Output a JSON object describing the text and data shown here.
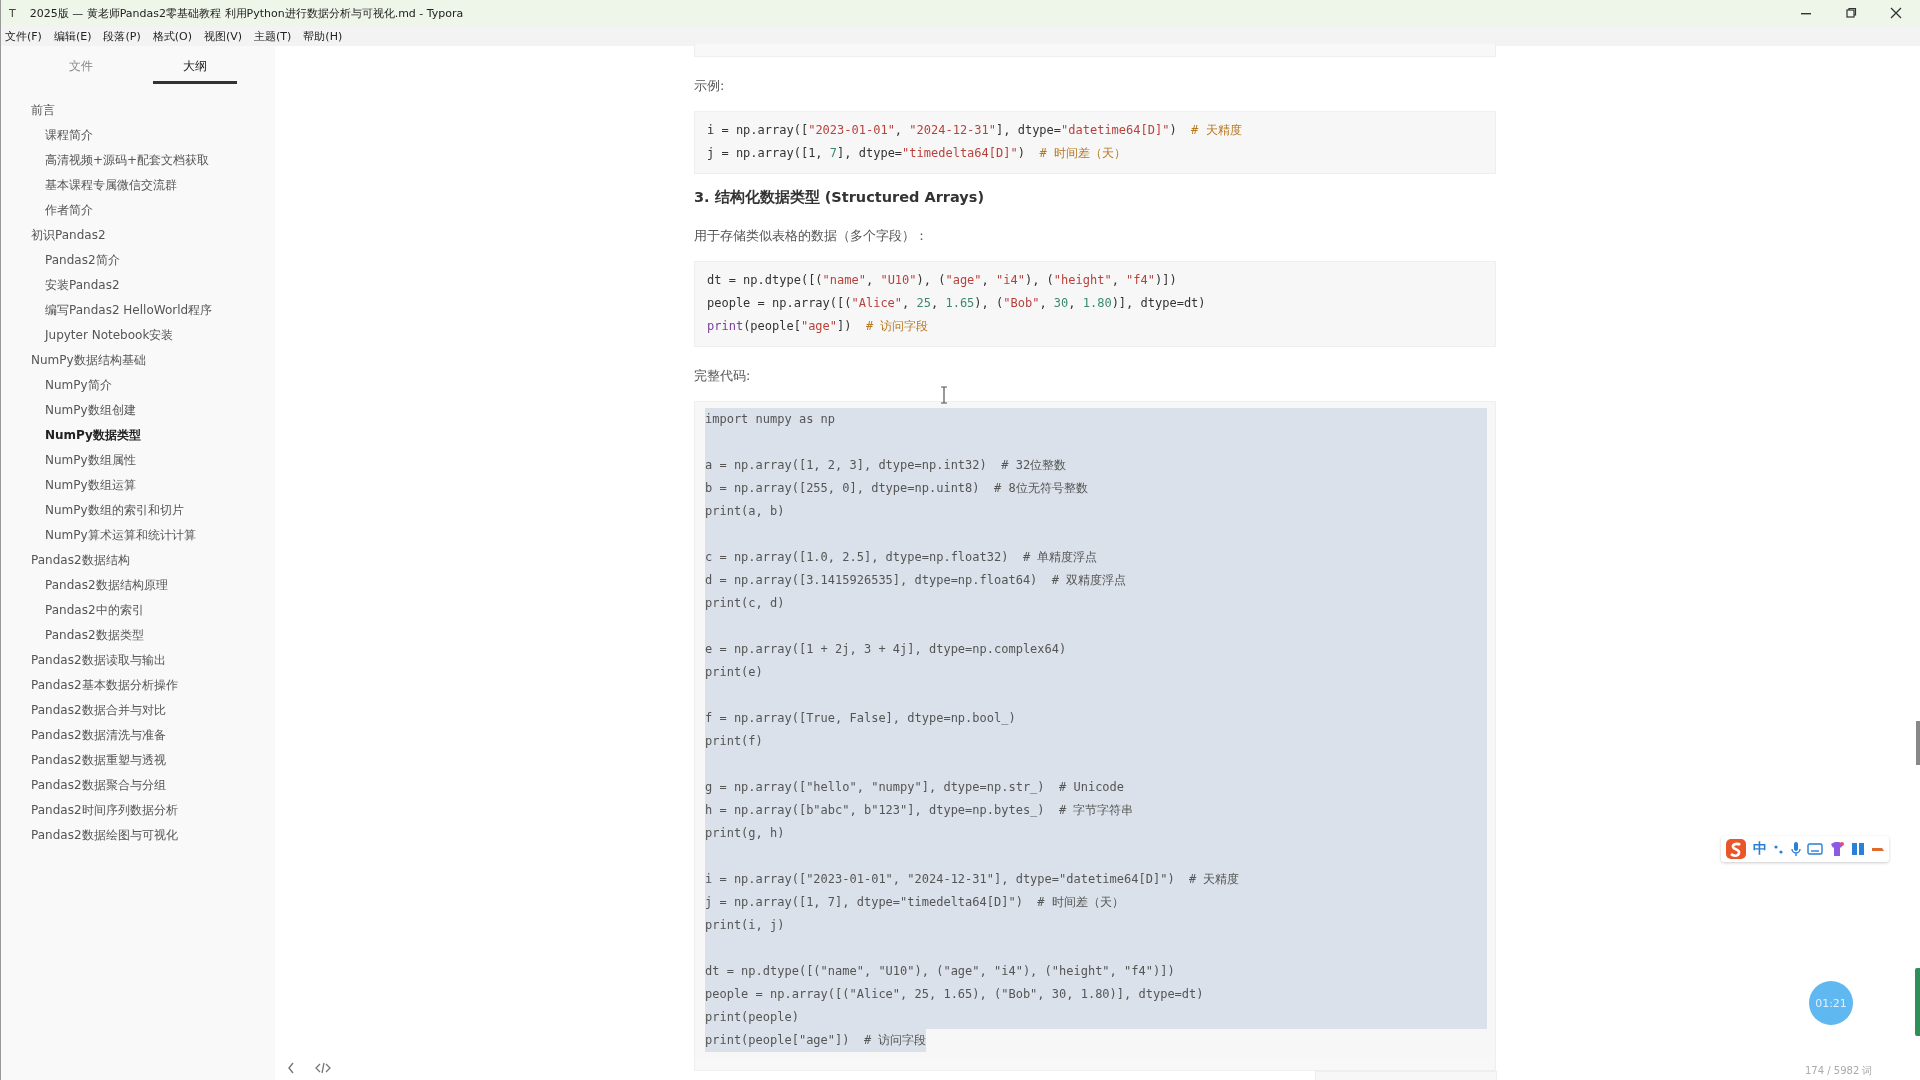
{
  "window": {
    "icon_glyph": "T",
    "title": "2025版 — 黄老师Pandas2零基础教程 利用Python进行数据分析与可视化.md - Typora"
  },
  "menu": [
    "文件(F)",
    "编辑(E)",
    "段落(P)",
    "格式(O)",
    "视图(V)",
    "主题(T)",
    "帮助(H)"
  ],
  "sidebar": {
    "tabs": [
      {
        "label": "文件",
        "selected": false
      },
      {
        "label": "大纲",
        "selected": true
      }
    ],
    "outline": [
      {
        "label": "前言",
        "selected": false,
        "children": [
          {
            "label": "课程简介",
            "selected": false
          },
          {
            "label": "高清视频+源码+配套文档获取",
            "selected": false
          },
          {
            "label": "基本课程专属微信交流群",
            "selected": false
          },
          {
            "label": "作者简介",
            "selected": false
          }
        ]
      },
      {
        "label": "初识Pandas2",
        "selected": false,
        "children": [
          {
            "label": "Pandas2简介",
            "selected": false
          },
          {
            "label": "安装Pandas2",
            "selected": false
          },
          {
            "label": "编写Pandas2 HelloWorld程序",
            "selected": false
          },
          {
            "label": "Jupyter Notebook安装",
            "selected": false
          }
        ]
      },
      {
        "label": "NumPy数据结构基础",
        "selected": false,
        "children": [
          {
            "label": "NumPy简介",
            "selected": false
          },
          {
            "label": "NumPy数组创建",
            "selected": false
          },
          {
            "label": "NumPy数据类型",
            "selected": true
          },
          {
            "label": "NumPy数组属性",
            "selected": false
          },
          {
            "label": "NumPy数组运算",
            "selected": false
          },
          {
            "label": "NumPy数组的索引和切片",
            "selected": false
          },
          {
            "label": "NumPy算术运算和统计计算",
            "selected": false
          }
        ]
      },
      {
        "label": "Pandas2数据结构",
        "selected": false,
        "children": [
          {
            "label": "Pandas2数据结构原理",
            "selected": false
          },
          {
            "label": "Pandas2中的索引",
            "selected": false
          },
          {
            "label": "Pandas2数据类型",
            "selected": false
          }
        ]
      },
      {
        "label": "Pandas2数据读取与输出",
        "selected": false
      },
      {
        "label": "Pandas2基本数据分析操作",
        "selected": false
      },
      {
        "label": "Pandas2数据合并与对比",
        "selected": false
      },
      {
        "label": "Pandas2数据清洗与准备",
        "selected": false
      },
      {
        "label": "Pandas2数据重塑与透视",
        "selected": false
      },
      {
        "label": "Pandas2数据聚合与分组",
        "selected": false
      },
      {
        "label": "Pandas2时间序列数据分析",
        "selected": false
      },
      {
        "label": "Pandas2数据绘图与可视化",
        "selected": false
      }
    ]
  },
  "document": [
    {
      "kind": "stub"
    },
    {
      "kind": "paragraph",
      "text": "示例:"
    },
    {
      "kind": "code",
      "selected": false,
      "lines": [
        {
          "kind": "text",
          "tokens": [
            {
              "text": "i = np.array([",
              "kind": "plain"
            },
            {
              "text": "\"2023-01-01\"",
              "kind": "string"
            },
            {
              "text": ", ",
              "kind": "plain"
            },
            {
              "text": "\"2024-12-31\"",
              "kind": "string"
            },
            {
              "text": "], dtype=",
              "kind": "plain"
            },
            {
              "text": "\"datetime64[D]\"",
              "kind": "string"
            },
            {
              "text": ")  ",
              "kind": "plain"
            },
            {
              "text": "# 天精度",
              "kind": "comment"
            }
          ]
        },
        {
          "kind": "text",
          "tokens": [
            {
              "text": "j = np.array([1, ",
              "kind": "plain"
            },
            {
              "text": "7",
              "kind": "number"
            },
            {
              "text": "], dtype=",
              "kind": "plain"
            },
            {
              "text": "\"timedelta64[D]\"",
              "kind": "string"
            },
            {
              "text": ")  ",
              "kind": "plain"
            },
            {
              "text": "# 时间差（天）",
              "kind": "comment"
            }
          ]
        }
      ]
    },
    {
      "kind": "heading",
      "text": "3. 结构化数据类型 (Structured Arrays)"
    },
    {
      "kind": "paragraph",
      "text": "用于存储类似表格的数据（多个字段）："
    },
    {
      "kind": "code",
      "selected": false,
      "lines": [
        {
          "kind": "text",
          "tokens": [
            {
              "text": "dt = np.dtype([(",
              "kind": "plain"
            },
            {
              "text": "\"name\"",
              "kind": "string"
            },
            {
              "text": ", ",
              "kind": "plain"
            },
            {
              "text": "\"U10\"",
              "kind": "string"
            },
            {
              "text": "), (",
              "kind": "plain"
            },
            {
              "text": "\"age\"",
              "kind": "string"
            },
            {
              "text": ", ",
              "kind": "plain"
            },
            {
              "text": "\"i4\"",
              "kind": "string"
            },
            {
              "text": "), (",
              "kind": "plain"
            },
            {
              "text": "\"height\"",
              "kind": "string"
            },
            {
              "text": ", ",
              "kind": "plain"
            },
            {
              "text": "\"f4\"",
              "kind": "string"
            },
            {
              "text": ")])",
              "kind": "plain"
            }
          ]
        },
        {
          "kind": "text",
          "tokens": [
            {
              "text": "people = np.array([(",
              "kind": "plain"
            },
            {
              "text": "\"Alice\"",
              "kind": "string"
            },
            {
              "text": ", ",
              "kind": "plain"
            },
            {
              "text": "25",
              "kind": "number"
            },
            {
              "text": ", ",
              "kind": "plain"
            },
            {
              "text": "1.65",
              "kind": "number"
            },
            {
              "text": "), (",
              "kind": "plain"
            },
            {
              "text": "\"Bob\"",
              "kind": "string"
            },
            {
              "text": ", ",
              "kind": "plain"
            },
            {
              "text": "30",
              "kind": "number"
            },
            {
              "text": ", ",
              "kind": "plain"
            },
            {
              "text": "1.80",
              "kind": "number"
            },
            {
              "text": ")], dtype=dt)",
              "kind": "plain"
            }
          ]
        },
        {
          "kind": "text",
          "tokens": [
            {
              "text": "print",
              "kind": "keyword"
            },
            {
              "text": "(people[",
              "kind": "plain"
            },
            {
              "text": "\"age\"",
              "kind": "string"
            },
            {
              "text": "])  ",
              "kind": "plain"
            },
            {
              "text": "# 访问字段",
              "kind": "comment"
            }
          ]
        }
      ]
    },
    {
      "kind": "paragraph",
      "text": "完整代码:"
    },
    {
      "kind": "code",
      "selected": true,
      "lines": [
        {
          "kind": "text",
          "tokens": [
            {
              "text": "import numpy as np",
              "kind": "plain"
            }
          ]
        },
        {
          "kind": "blank"
        },
        {
          "kind": "text",
          "tokens": [
            {
              "text": "a = np.array([1, 2, 3], dtype=np.int32)  # 32位整数",
              "kind": "plain"
            }
          ]
        },
        {
          "kind": "text",
          "tokens": [
            {
              "text": "b = np.array([255, 0], dtype=np.uint8)  # 8位无符号整数",
              "kind": "plain"
            }
          ]
        },
        {
          "kind": "text",
          "tokens": [
            {
              "text": "print(a, b)",
              "kind": "plain"
            }
          ]
        },
        {
          "kind": "blank"
        },
        {
          "kind": "text",
          "tokens": [
            {
              "text": "c = np.array([1.0, 2.5], dtype=np.float32)  # 单精度浮点",
              "kind": "plain"
            }
          ]
        },
        {
          "kind": "text",
          "tokens": [
            {
              "text": "d = np.array([3.1415926535], dtype=np.float64)  # 双精度浮点",
              "kind": "plain"
            }
          ]
        },
        {
          "kind": "text",
          "tokens": [
            {
              "text": "print(c, d)",
              "kind": "plain"
            }
          ]
        },
        {
          "kind": "blank"
        },
        {
          "kind": "text",
          "tokens": [
            {
              "text": "e = np.array([1 + 2j, 3 + 4j], dtype=np.complex64)",
              "kind": "plain"
            }
          ]
        },
        {
          "kind": "text",
          "tokens": [
            {
              "text": "print(e)",
              "kind": "plain"
            }
          ]
        },
        {
          "kind": "blank"
        },
        {
          "kind": "text",
          "tokens": [
            {
              "text": "f = np.array([True, False], dtype=np.bool_)",
              "kind": "plain"
            }
          ]
        },
        {
          "kind": "text",
          "tokens": [
            {
              "text": "print(f)",
              "kind": "plain"
            }
          ]
        },
        {
          "kind": "blank"
        },
        {
          "kind": "text",
          "tokens": [
            {
              "text": "g = np.array([\"hello\", \"numpy\"], dtype=np.str_)  # Unicode",
              "kind": "plain"
            }
          ]
        },
        {
          "kind": "text",
          "tokens": [
            {
              "text": "h = np.array([b\"abc\", b\"123\"], dtype=np.bytes_)  # 字节字符串",
              "kind": "plain"
            }
          ]
        },
        {
          "kind": "text",
          "tokens": [
            {
              "text": "print(g, h)",
              "kind": "plain"
            }
          ]
        },
        {
          "kind": "blank"
        },
        {
          "kind": "text",
          "tokens": [
            {
              "text": "i = np.array([\"2023-01-01\", \"2024-12-31\"], dtype=\"datetime64[D]\")  # 天精度",
              "kind": "plain"
            }
          ]
        },
        {
          "kind": "text",
          "tokens": [
            {
              "text": "j = np.array([1, 7], dtype=\"timedelta64[D]\")  # 时间差（天）",
              "kind": "plain"
            }
          ]
        },
        {
          "kind": "text",
          "tokens": [
            {
              "text": "print(i, j)",
              "kind": "plain"
            }
          ]
        },
        {
          "kind": "blank"
        },
        {
          "kind": "text",
          "tokens": [
            {
              "text": "dt = np.dtype([(\"name\", \"U10\"), (\"age\", \"i4\"), (\"height\", \"f4\")])",
              "kind": "plain"
            }
          ]
        },
        {
          "kind": "text",
          "tokens": [
            {
              "text": "people = np.array([(\"Alice\", 25, 1.65), (\"Bob\", 30, 1.80)], dtype=dt)",
              "kind": "plain"
            }
          ]
        },
        {
          "kind": "text",
          "tokens": [
            {
              "text": "print(people)",
              "kind": "plain"
            }
          ]
        },
        {
          "kind": "text",
          "tokens": [
            {
              "text": "print(people[\"age\"])  # 访问字段",
              "kind": "plain"
            }
          ]
        }
      ]
    },
    {
      "kind": "stub"
    }
  ],
  "ime": {
    "glyph": "中"
  },
  "timer": "01:21",
  "word_count": "174 / 5982 词"
}
